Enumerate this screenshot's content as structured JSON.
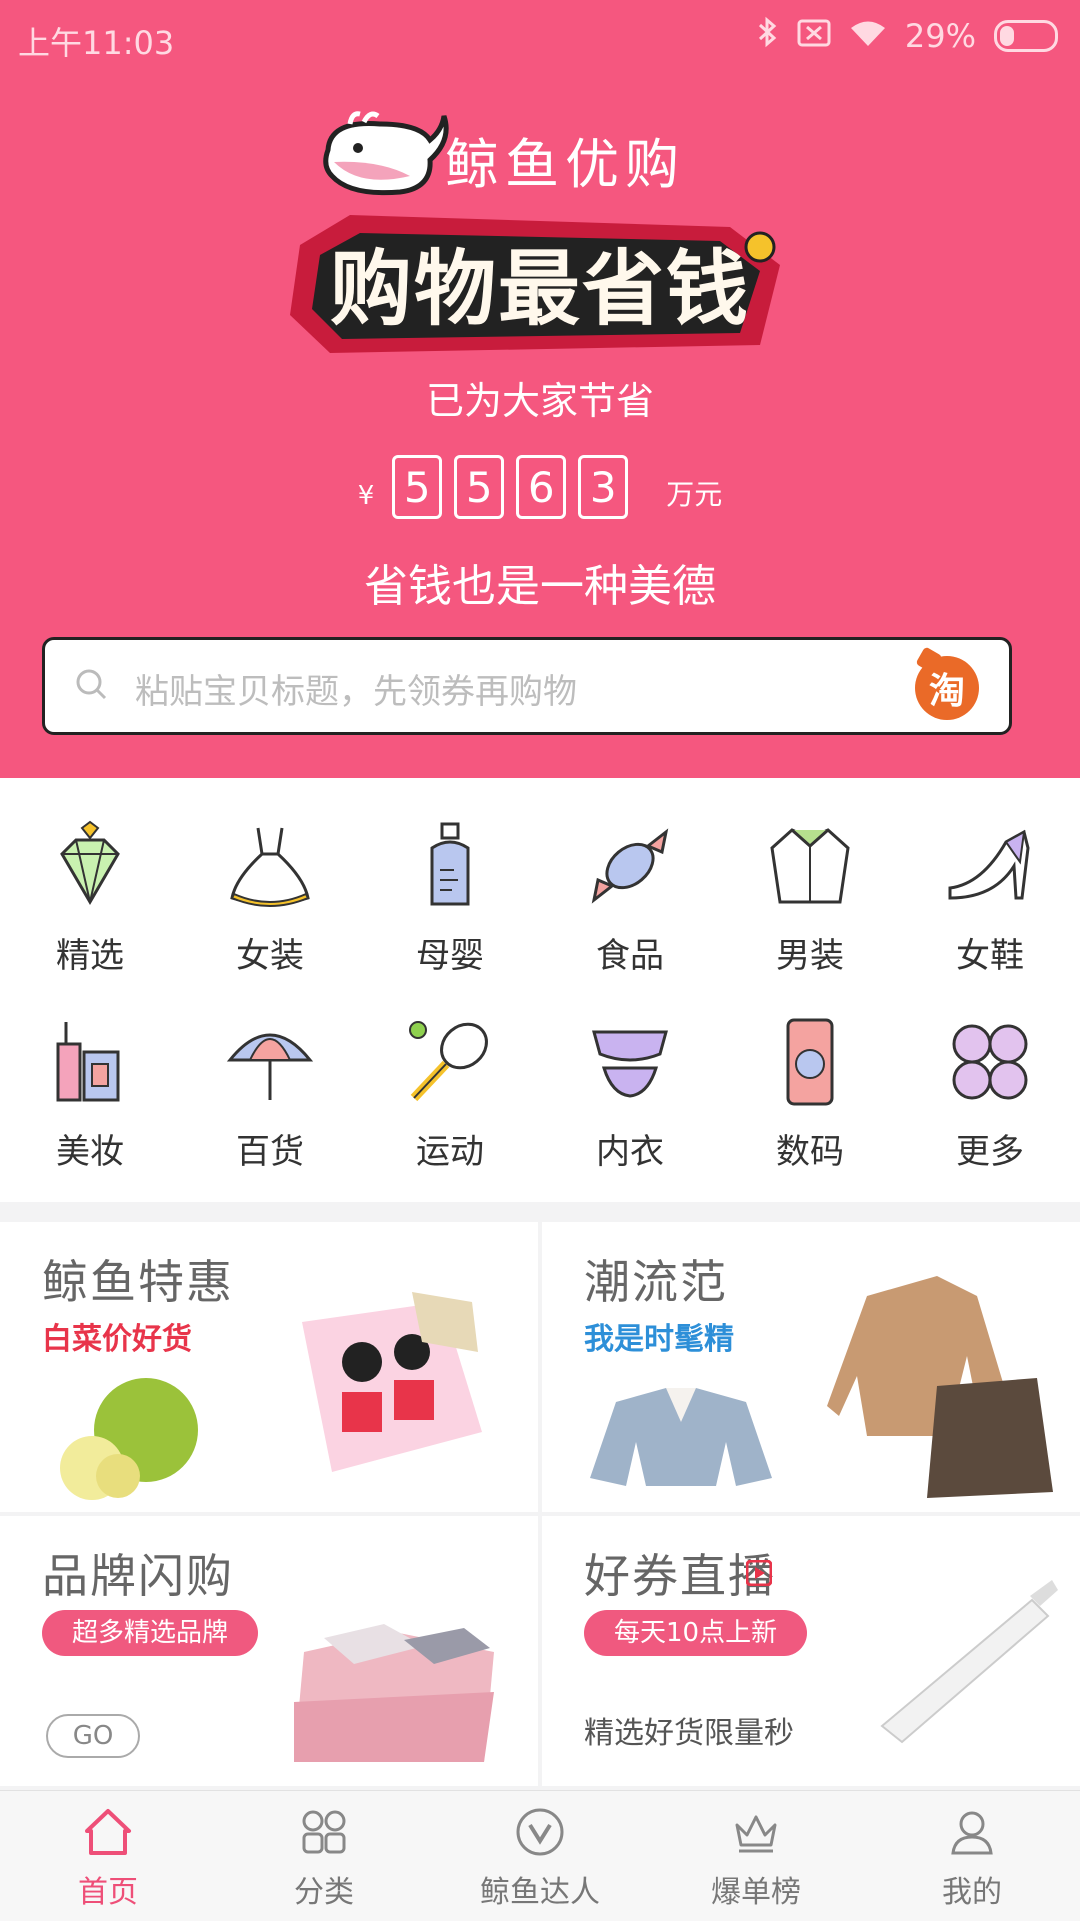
{
  "status_bar": {
    "time": "上午11:03",
    "battery": "29%"
  },
  "header": {
    "brand_name": "鲸鱼优购",
    "slogan": "购物最省钱",
    "saved_label": "已为大家节省",
    "currency": "¥",
    "saved_digits": [
      "5",
      "5",
      "6",
      "3"
    ],
    "saved_unit": "万元",
    "motto": "省钱也是一种美德"
  },
  "search": {
    "placeholder": "粘贴宝贝标题，先领券再购物",
    "taobao_badge": "淘"
  },
  "categories": [
    {
      "label": "精选",
      "icon": "diamond-icon"
    },
    {
      "label": "女装",
      "icon": "dress-icon"
    },
    {
      "label": "母婴",
      "icon": "bottle-icon"
    },
    {
      "label": "食品",
      "icon": "candy-icon"
    },
    {
      "label": "男装",
      "icon": "shirt-icon"
    },
    {
      "label": "女鞋",
      "icon": "heel-icon"
    },
    {
      "label": "美妆",
      "icon": "cosmetics-icon"
    },
    {
      "label": "百货",
      "icon": "umbrella-icon"
    },
    {
      "label": "运动",
      "icon": "racket-icon"
    },
    {
      "label": "内衣",
      "icon": "lingerie-icon"
    },
    {
      "label": "数码",
      "icon": "phone-icon"
    },
    {
      "label": "更多",
      "icon": "more-icon"
    }
  ],
  "promos": {
    "tehui": {
      "title": "鲸鱼特惠",
      "subtitle": "白菜价好货"
    },
    "chaoliu": {
      "title": "潮流范",
      "subtitle": "我是时髦精"
    },
    "brand": {
      "title": "品牌闪购",
      "pill": "超多精选品牌",
      "go": "GO"
    },
    "live": {
      "title": "好券直播",
      "pill": "每天10点上新",
      "desc": "精选好货限量秒"
    }
  },
  "tabbar": [
    {
      "label": "首页",
      "icon": "home-icon",
      "active": true
    },
    {
      "label": "分类",
      "icon": "grid-icon",
      "active": false
    },
    {
      "label": "鲸鱼达人",
      "icon": "v-badge-icon",
      "active": false
    },
    {
      "label": "爆单榜",
      "icon": "crown-icon",
      "active": false
    },
    {
      "label": "我的",
      "icon": "user-icon",
      "active": false
    }
  ],
  "colors": {
    "brand_pink": "#f5577f",
    "accent_red": "#e8344a",
    "accent_blue": "#2d8fd8",
    "taobao_orange": "#ea6a28"
  }
}
